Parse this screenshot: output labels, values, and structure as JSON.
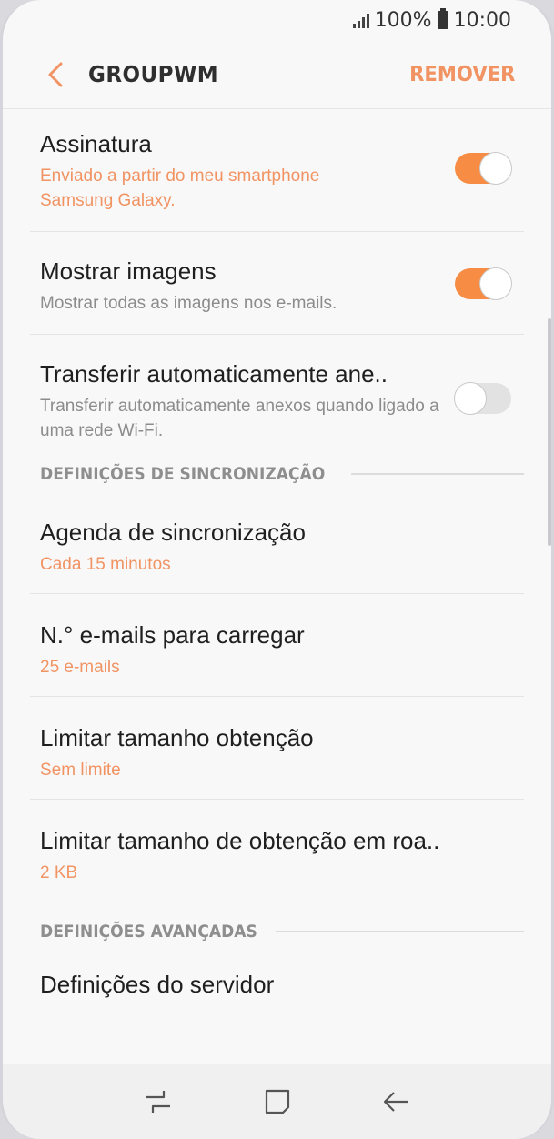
{
  "status_bar": {
    "battery_text": "100%",
    "time": "10:00"
  },
  "app_bar": {
    "title": "GROUPWM",
    "remove_label": "REMOVER"
  },
  "colors": {
    "accent": "#f19363",
    "toggle_on": "#f78d45"
  },
  "settings": {
    "signature": {
      "title": "Assinatura",
      "subtitle": "Enviado a partir do meu smartphone Samsung Galaxy.",
      "enabled": true
    },
    "show_images": {
      "title": "Mostrar imagens",
      "subtitle": "Mostrar todas as imagens nos e-mails.",
      "enabled": true
    },
    "auto_download": {
      "title": "Transferir automaticamente ane..",
      "subtitle": "Transferir automaticamente anexos quando ligado a uma rede Wi-Fi.",
      "enabled": false
    }
  },
  "sync_section": {
    "header": "DEFINIÇÕES DE SINCRONIZAÇÃO",
    "items": [
      {
        "title": "Agenda de sincronização",
        "value": "Cada 15 minutos"
      },
      {
        "title": "N.° e-mails para carregar",
        "value": "25 e-mails"
      },
      {
        "title": "Limitar tamanho obtenção",
        "value": "Sem limite"
      },
      {
        "title": "Limitar tamanho de obtenção em roa..",
        "value": "2 KB"
      }
    ]
  },
  "advanced_section": {
    "header": "DEFINIÇÕES AVANÇADAS",
    "items": [
      {
        "title": "Definições do servidor"
      }
    ]
  },
  "nav_bar": {
    "icons": [
      "recent-apps-icon",
      "home-icon",
      "back-icon"
    ]
  }
}
